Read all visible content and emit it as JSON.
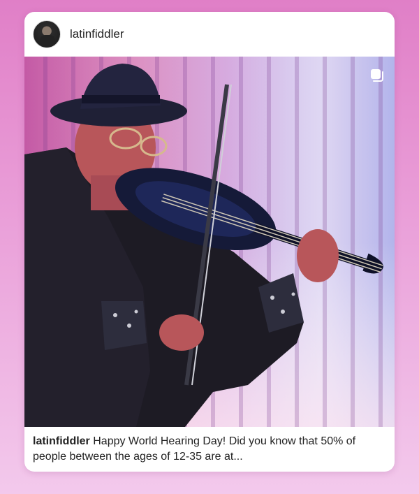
{
  "post": {
    "username": "latinfiddler",
    "avatar_icon": "profile-photo",
    "media_badge_icon": "multiple-posts-icon",
    "caption_username": "latinfiddler",
    "caption_text": "Happy World Hearing Day! Did you know that 50% of people between the ages of 12-35 are at..."
  },
  "colors": {
    "background_top": "#e07fc7",
    "background_bottom": "#f3c9ec",
    "card": "#ffffff",
    "text": "#222222"
  }
}
